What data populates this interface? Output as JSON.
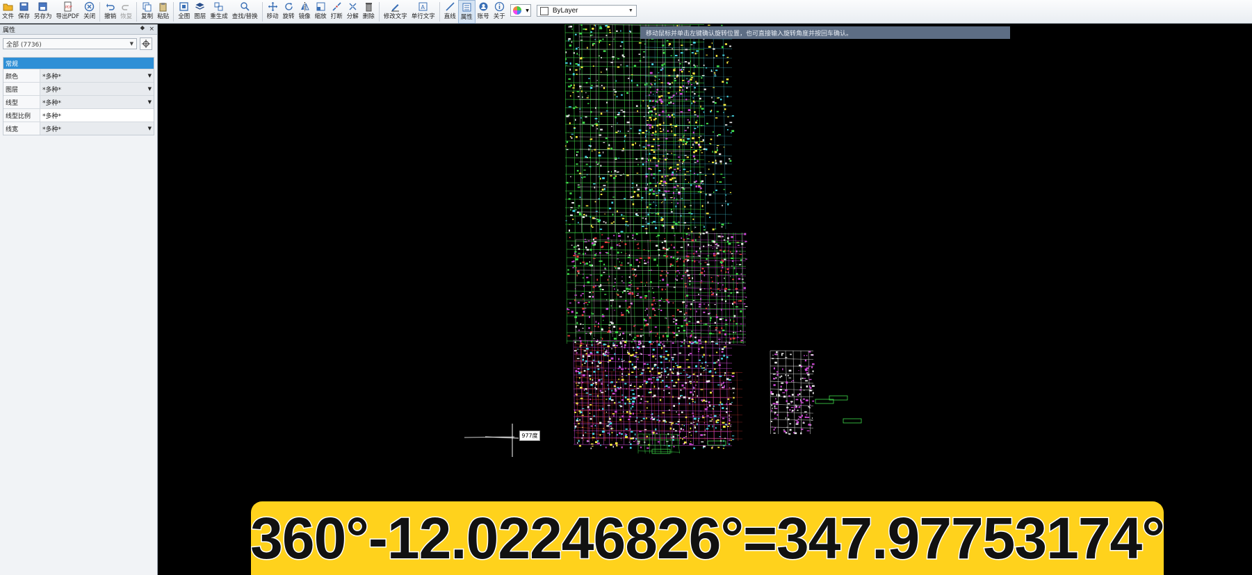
{
  "toolbar": {
    "items": [
      {
        "id": "file",
        "label": "文件",
        "icon": "folder-icon",
        "disabled": false,
        "dropdown": false
      },
      {
        "id": "save",
        "label": "保存",
        "icon": "save-icon",
        "disabled": false,
        "dropdown": false
      },
      {
        "id": "saveas",
        "label": "另存为",
        "icon": "save-as-icon",
        "disabled": false,
        "dropdown": false
      },
      {
        "id": "exportpdf",
        "label": "导出PDF",
        "icon": "pdf-icon",
        "disabled": false,
        "dropdown": true
      },
      {
        "id": "close",
        "label": "关闭",
        "icon": "close-circle-icon",
        "disabled": false,
        "dropdown": false
      },
      {
        "sep": true
      },
      {
        "id": "undo",
        "label": "撤销",
        "icon": "undo-icon",
        "disabled": false,
        "dropdown": false
      },
      {
        "id": "redo",
        "label": "恢复",
        "icon": "redo-icon",
        "disabled": true,
        "dropdown": false
      },
      {
        "sep": true
      },
      {
        "id": "copy",
        "label": "复制",
        "icon": "copy-icon",
        "disabled": false,
        "dropdown": true
      },
      {
        "id": "paste",
        "label": "粘贴",
        "icon": "paste-icon",
        "disabled": false,
        "dropdown": false
      },
      {
        "sep": true
      },
      {
        "id": "zoomall",
        "label": "全图",
        "icon": "zoom-extents-icon",
        "disabled": false,
        "dropdown": false
      },
      {
        "id": "layers",
        "label": "图层",
        "icon": "layers-icon",
        "disabled": false,
        "dropdown": false
      },
      {
        "id": "regen",
        "label": "重生成",
        "icon": "regen-icon",
        "disabled": false,
        "dropdown": false
      },
      {
        "id": "findreplace",
        "label": "查找/替换",
        "icon": "find-replace-icon",
        "disabled": false,
        "dropdown": false
      },
      {
        "sep": true
      },
      {
        "id": "move",
        "label": "移动",
        "icon": "move-icon",
        "disabled": false,
        "dropdown": false
      },
      {
        "id": "rotate",
        "label": "旋转",
        "icon": "rotate-icon",
        "disabled": false,
        "dropdown": false
      },
      {
        "id": "mirror",
        "label": "镜像",
        "icon": "mirror-icon",
        "disabled": false,
        "dropdown": false
      },
      {
        "id": "scale",
        "label": "缩放",
        "icon": "scale-icon",
        "disabled": false,
        "dropdown": false
      },
      {
        "id": "break",
        "label": "打断",
        "icon": "break-icon",
        "disabled": false,
        "dropdown": false
      },
      {
        "id": "explode",
        "label": "分解",
        "icon": "explode-icon",
        "disabled": false,
        "dropdown": false
      },
      {
        "id": "delete",
        "label": "删除",
        "icon": "delete-icon",
        "disabled": false,
        "dropdown": false
      },
      {
        "sep": true
      },
      {
        "id": "edittext",
        "label": "修改文字",
        "icon": "edit-text-icon",
        "disabled": false,
        "dropdown": false
      },
      {
        "id": "singletext",
        "label": "单行文字",
        "icon": "single-text-icon",
        "disabled": false,
        "dropdown": false
      },
      {
        "sep": true
      },
      {
        "id": "line",
        "label": "直线",
        "icon": "line-icon",
        "disabled": false,
        "dropdown": true
      },
      {
        "id": "properties",
        "label": "属性",
        "icon": "properties-icon",
        "disabled": false,
        "dropdown": false,
        "active": true
      },
      {
        "id": "account",
        "label": "账号",
        "icon": "account-icon",
        "disabled": false,
        "dropdown": false
      },
      {
        "id": "about",
        "label": "关于",
        "icon": "info-icon",
        "disabled": false,
        "dropdown": false
      }
    ],
    "layer_value": "ByLayer"
  },
  "panel": {
    "title": "属性",
    "pin": "⯁",
    "close": "×",
    "selection": "全部 (7736)",
    "category": "常规",
    "rows": [
      {
        "key": "颜色",
        "value": "*多种*",
        "dropdown": true
      },
      {
        "key": "图层",
        "value": "*多种*",
        "dropdown": true
      },
      {
        "key": "线型",
        "value": "*多种*",
        "dropdown": true
      },
      {
        "key": "线型比例",
        "value": "*多种*",
        "dropdown": false
      },
      {
        "key": "线宽",
        "value": "*多种*",
        "dropdown": true
      }
    ]
  },
  "canvas": {
    "hint": "移动鼠标并单击左键确认旋转位置，也可直接输入旋转角度并按回车确认。",
    "cursor_value": "977度",
    "colors": {
      "green": "#3fdc4a",
      "white": "#e6e6e6",
      "magenta": "#d04ad8",
      "red": "#e23b3b",
      "yellow": "#f2e640",
      "cyan": "#48d6e6"
    }
  },
  "subtitle": "360°-12.02246826°=347.97753174°"
}
